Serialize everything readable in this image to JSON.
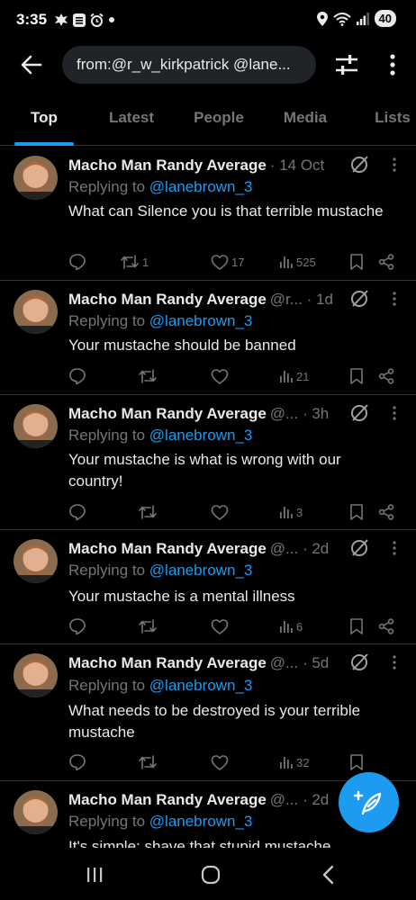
{
  "status_bar": {
    "time": "3:35",
    "left_icons": [
      "leaf-icon",
      "mail-icon",
      "alarm-icon",
      "dot-icon"
    ],
    "right_icons": [
      "location-icon",
      "wifi-icon",
      "signal-icon"
    ],
    "battery": "40"
  },
  "header": {
    "search_query": "from:@r_w_kirkpatrick @lane..."
  },
  "tabs": [
    {
      "label": "Top",
      "active": true
    },
    {
      "label": "Latest",
      "active": false
    },
    {
      "label": "People",
      "active": false
    },
    {
      "label": "Media",
      "active": false
    },
    {
      "label": "Lists",
      "active": false
    }
  ],
  "tweets": [
    {
      "author": "Macho Man Randy Average",
      "meta": "· 14 Oct",
      "replying_prefix": "Replying to ",
      "replying_handle": "@lanebrown_3",
      "text": "What can Silence you is that terrible mustache",
      "retweets": "1",
      "likes": "17",
      "views": "525"
    },
    {
      "author": "Macho Man Randy Average",
      "meta": "@r... · 1d",
      "replying_prefix": "Replying to ",
      "replying_handle": "@lanebrown_3",
      "text": "Your mustache should be banned",
      "retweets": "",
      "likes": "",
      "views": "21"
    },
    {
      "author": "Macho Man Randy Average",
      "meta": "@... · 3h",
      "replying_prefix": "Replying to ",
      "replying_handle": "@lanebrown_3",
      "text": "Your mustache is what is wrong with our country!",
      "retweets": "",
      "likes": "",
      "views": "3"
    },
    {
      "author": "Macho Man Randy Average",
      "meta": "@... · 2d",
      "replying_prefix": "Replying to ",
      "replying_handle": "@lanebrown_3",
      "text": "Your mustache is a mental illness",
      "retweets": "",
      "likes": "",
      "views": "6"
    },
    {
      "author": "Macho Man Randy Average",
      "meta": "@... · 5d",
      "replying_prefix": "Replying to ",
      "replying_handle": "@lanebrown_3",
      "text": "What needs to be destroyed is your terrible mustache",
      "retweets": "",
      "likes": "",
      "views": "32"
    },
    {
      "author": "Macho Man Randy Average",
      "meta": "@... · 2d",
      "replying_prefix": "Replying to ",
      "replying_handle": "@lanebrown_3",
      "text": "It's simple: shave that stupid mustache"
    }
  ],
  "colors": {
    "background": "#000000",
    "accent": "#1d9bf0",
    "text_primary": "#e7e9ea",
    "text_secondary": "#71767b",
    "divider": "#2f3336"
  },
  "nav_bar": {
    "icons": [
      "recent-apps-icon",
      "home-icon",
      "back-icon"
    ]
  }
}
